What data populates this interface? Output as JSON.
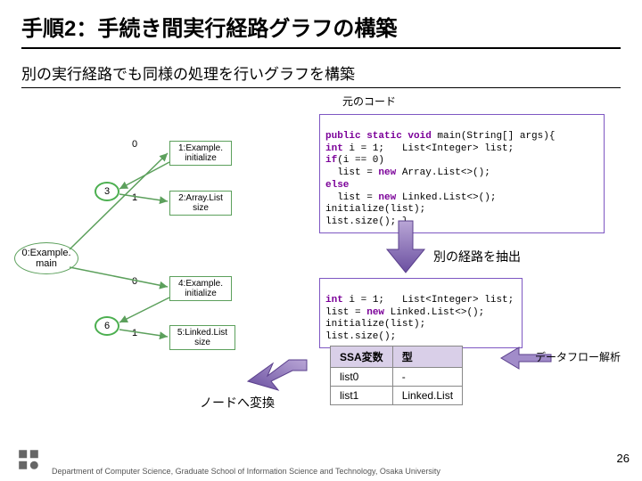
{
  "title": "手順2：手続き間実行経路グラフの構築",
  "subtitle": "別の実行経路でも同様の処理を行いグラフを構築",
  "src_label": "元のコード",
  "code_main": "public static void main(String[] args){\nint i = 1;   List<Integer> list;\nif(i == 0)\n  list = new Array.List<>();\nelse\n  list = new Linked.List<>();\ninitialize(list);\nlist.size(); }",
  "code_path": "int i = 1;   List<Integer> list;\nlist = new Linked.List<>();\ninitialize(list);\nlist.size();",
  "graph": {
    "root": "0:Example.\nmain",
    "top": {
      "edge0": "0",
      "node0": "1:Example.\ninitialize",
      "leaf": "3",
      "edge1": "1",
      "node1": "2:Array.List\nsize"
    },
    "bottom": {
      "edge0": "0",
      "node0": "4:Example.\ninitialize",
      "leaf": "6",
      "edge1": "1",
      "node1": "5:Linked.List\nsize"
    }
  },
  "annot_extract": "別の経路を抽出",
  "annot_node": "ノードへ変換",
  "ssa": {
    "h1": "SSA変数",
    "h2": "型",
    "rows": [
      {
        "v": "list0",
        "t": "-"
      },
      {
        "v": "list1",
        "t": "Linked.List"
      }
    ]
  },
  "annot_dataflow": "データフロー解析",
  "footer": "Department of Computer Science, Graduate School of Information Science and Technology, Osaka University",
  "pagenum": "26"
}
